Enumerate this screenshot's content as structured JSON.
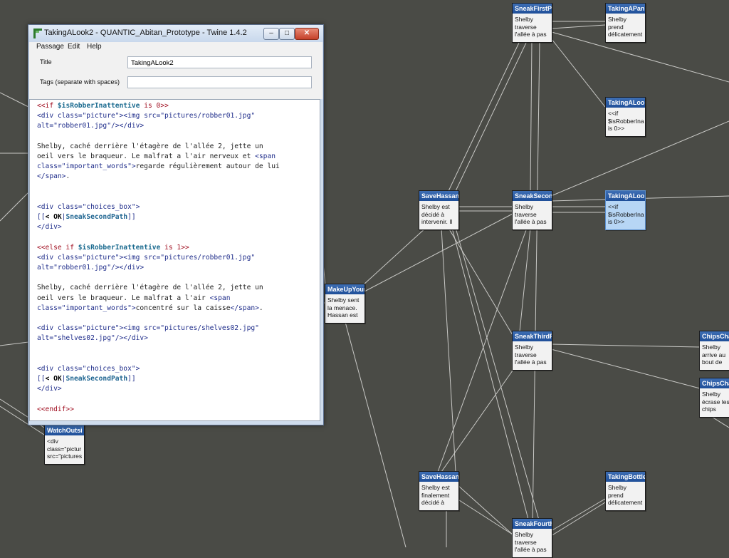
{
  "window": {
    "title": "TakingALook2 - QUANTIC_Abitan_Prototype - Twine 1.4.2",
    "minimize_glyph": "–",
    "maximize_glyph": "□",
    "close_glyph": "✕"
  },
  "menu": {
    "passage": "Passage",
    "edit": "Edit",
    "help": "Help"
  },
  "form": {
    "title_label": "Title",
    "title_value": "TakingALook2",
    "tags_label": "Tags (separate with spaces)",
    "tags_value": ""
  },
  "colors": {
    "canvas": "#4a4b46",
    "card_header": "#2a5ea8",
    "selected_card": "#b7d6f5",
    "macro": "#a00d1f",
    "variable": "#1a6a8f",
    "html_tag": "#1e2c8a"
  },
  "passage_text_lines": [
    [
      {
        "t": "<<if ",
        "c": "m"
      },
      {
        "t": "$isRobberInattentive",
        "c": "v"
      },
      {
        "t": " is ",
        "c": "m"
      },
      {
        "t": "0",
        "c": "m"
      },
      {
        "t": ">>",
        "c": "m"
      }
    ],
    [
      {
        "t": "<div class=\"picture\"><img src=\"pictures/robber01.jpg\"",
        "c": "h"
      }
    ],
    [
      {
        "t": "alt=\"robber01.jpg\"/></div>",
        "c": "h"
      }
    ],
    [],
    [
      {
        "t": "Shelby, caché derrière l'étagère de l'allée 2, jette un",
        "c": ""
      }
    ],
    [
      {
        "t": "oeil vers le braqueur. Le malfrat a l'air nerveux et ",
        "c": ""
      },
      {
        "t": "<span",
        "c": "h"
      }
    ],
    [
      {
        "t": "class=\"important_words\">",
        "c": "h"
      },
      {
        "t": "regarde régulièrement autour de lui",
        "c": ""
      }
    ],
    [
      {
        "t": "</span>",
        "c": "h"
      },
      {
        "t": ".",
        "c": ""
      }
    ],
    [],
    [],
    [
      {
        "t": "<div class=\"choices_box\">",
        "c": "h"
      }
    ],
    [
      {
        "t": "[[",
        "c": "l"
      },
      {
        "t": "< OK",
        "c": "lb"
      },
      {
        "t": "|",
        "c": "l"
      },
      {
        "t": "SneakSecondPath",
        "c": "lt"
      },
      {
        "t": "]]",
        "c": "l"
      }
    ],
    [
      {
        "t": "</div>",
        "c": "h"
      }
    ],
    [],
    [
      {
        "t": "<<else if ",
        "c": "m"
      },
      {
        "t": "$isRobberInattentive",
        "c": "v"
      },
      {
        "t": " is ",
        "c": "m"
      },
      {
        "t": "1",
        "c": "m"
      },
      {
        "t": ">>",
        "c": "m"
      }
    ],
    [
      {
        "t": "<div class=\"picture\"><img src=\"pictures/robber01.jpg\"",
        "c": "h"
      }
    ],
    [
      {
        "t": "alt=\"robber01.jpg\"/></div>",
        "c": "h"
      }
    ],
    [],
    [
      {
        "t": "Shelby, caché derrière l'étagère de l'allée 2, jette un",
        "c": ""
      }
    ],
    [
      {
        "t": "oeil vers le braqueur. Le malfrat a l'air ",
        "c": ""
      },
      {
        "t": "<span",
        "c": "h"
      }
    ],
    [
      {
        "t": "class=\"important_words\">",
        "c": "h"
      },
      {
        "t": "concentré sur la caisse",
        "c": ""
      },
      {
        "t": "</span>",
        "c": "h"
      },
      {
        "t": ".",
        "c": ""
      }
    ],
    [],
    [
      {
        "t": "<div class=\"picture\"><img src=\"pictures/shelves02.jpg\"",
        "c": "h"
      }
    ],
    [
      {
        "t": "alt=\"shelves02.jpg\"/></div>",
        "c": "h"
      }
    ],
    [],
    [],
    [
      {
        "t": "<div class=\"choices_box\">",
        "c": "h"
      }
    ],
    [
      {
        "t": "[[",
        "c": "l"
      },
      {
        "t": "< OK",
        "c": "lb"
      },
      {
        "t": "|",
        "c": "l"
      },
      {
        "t": "SneakSecondPath",
        "c": "lt"
      },
      {
        "t": "]]",
        "c": "l"
      }
    ],
    [
      {
        "t": "</div>",
        "c": "h"
      }
    ],
    [],
    [
      {
        "t": "<<endif>>",
        "c": "m"
      }
    ]
  ],
  "passages": {
    "sneakfirst": {
      "title": "SneakFirstPa",
      "body": "Shelby\ntraverse\nl'allée à pas"
    },
    "takingapan": {
      "title": "TakingAPan",
      "body": "Shelby\nprend\ndélicatement"
    },
    "takingalook_top": {
      "title": "TakingALool",
      "body": "<<if\n$isRobberIna\nis 0>>"
    },
    "savehassan1": {
      "title": "SaveHassan",
      "body": "Shelby est\ndécidé à\nintervenir. Il"
    },
    "sneaksecond": {
      "title": "SneakSecon",
      "body": "Shelby\ntraverse\nl'allée à pas"
    },
    "takingalook2": {
      "title": "TakingALool",
      "body": "<<if\n$isRobberIna\nis 0>>"
    },
    "makeupyour": {
      "title": "MakeUpYour",
      "body": "Shelby sent\nla menace.\nHassan est"
    },
    "sneakthird": {
      "title": "SneakThirdP",
      "body": "Shelby\ntraverse\nl'allée à pas"
    },
    "chipscha1": {
      "title": "ChipsCha",
      "body": "Shelby\narrive au\nbout de"
    },
    "chipscha2": {
      "title": "ChipsCha",
      "body": "Shelby\nécrase les\nchips"
    },
    "watchoutside": {
      "title": "WatchOutsi",
      "body": "<div\nclass=\"pictur\nsrc=\"pictures"
    },
    "savehassan2": {
      "title": "SaveHassan",
      "body": "Shelby est\nfinalement\ndécidé à"
    },
    "takingbottle": {
      "title": "TakingBottle",
      "body": "Shelby\nprend\ndélicatement"
    },
    "sneakfourth": {
      "title": "SneakFourth",
      "body": "Shelby\ntraverse\nl'allée à pas"
    }
  }
}
